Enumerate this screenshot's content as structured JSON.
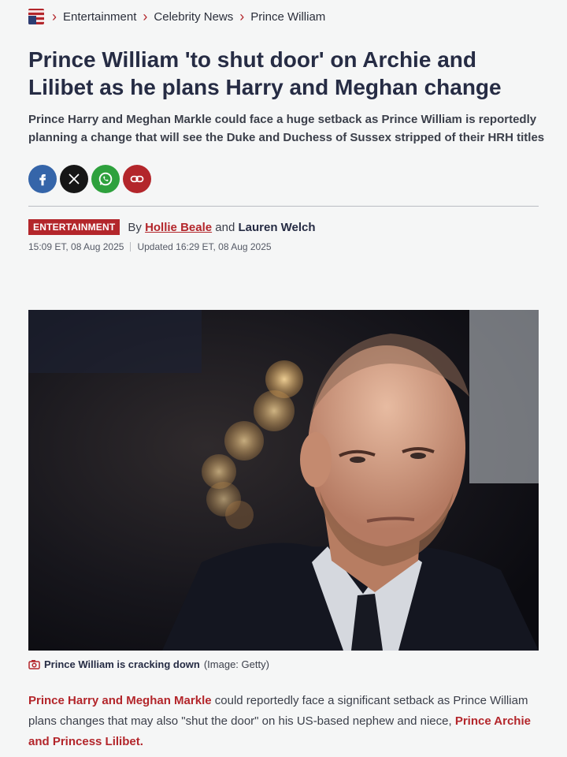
{
  "breadcrumb": {
    "items": [
      "Entertainment",
      "Celebrity News",
      "Prince William"
    ]
  },
  "article": {
    "headline": "Prince William 'to shut door' on Archie and Lilibet as he plans Harry and Meghan change",
    "standfirst": "Prince Harry and Meghan Markle could face a huge setback as Prince William is reportedly planning a change that will see the Duke and Duchess of Sussex stripped of their HRH titles",
    "section_tag": "ENTERTAINMENT",
    "by_prefix": "By",
    "author_1": "Hollie Beale",
    "and_word": "and",
    "author_2": "Lauren Welch",
    "published": "15:09 ET, 08 Aug 2025",
    "updated": "Updated 16:29 ET, 08 Aug 2025",
    "caption": "Prince William is cracking down",
    "credit": "(Image: Getty)",
    "body": {
      "link_1": "Prince Harry and Meghan Markle",
      "text_1": " could reportedly face a significant setback as Prince William plans changes that may also \"shut the door\" on his US-based nephew and niece, ",
      "link_2": "Prince Archie and Princess Lilibet."
    }
  },
  "share": {
    "icons": [
      "facebook-icon",
      "x-icon",
      "whatsapp-icon",
      "link-icon"
    ]
  },
  "colors": {
    "brand_red": "#b3262b",
    "headline": "#262c44",
    "background": "#f5f6f6",
    "facebook": "#3565a9",
    "whatsapp": "#2ea13d"
  }
}
